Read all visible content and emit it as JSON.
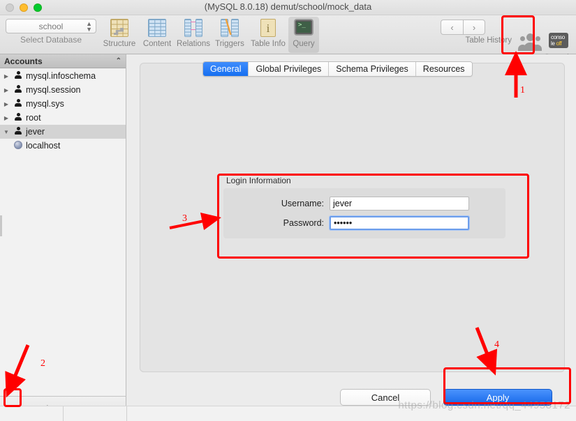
{
  "window": {
    "title": "(MySQL 8.0.18) demut/school/mock_data",
    "controls": {
      "close": "close-button",
      "minimize": "minimize-button",
      "maximize": "maximize-button"
    }
  },
  "toolbar": {
    "db_select_value": "school",
    "db_select_label": "Select Database",
    "items": [
      {
        "label": "Structure",
        "icon": "structure-icon",
        "selected": false
      },
      {
        "label": "Content",
        "icon": "content-icon",
        "selected": false
      },
      {
        "label": "Relations",
        "icon": "relations-icon",
        "selected": false
      },
      {
        "label": "Triggers",
        "icon": "triggers-icon",
        "selected": false
      },
      {
        "label": "Table Info",
        "icon": "table-info-icon",
        "selected": false
      },
      {
        "label": "Query",
        "icon": "query-icon",
        "selected": true
      }
    ],
    "nav_back": "‹",
    "nav_forward": "›",
    "table_history_label": "Table History",
    "users_label": "Users",
    "console_label": "Console",
    "console_icon_line1": "conso",
    "console_icon_line2a": "le ",
    "console_icon_line2b": "off"
  },
  "sidebar": {
    "header": "Accounts",
    "collapse_chevron": "⌃",
    "items": [
      {
        "label": "mysql.infoschema",
        "icon": "user-icon",
        "expanded": false,
        "selected": false,
        "child": false
      },
      {
        "label": "mysql.session",
        "icon": "user-icon",
        "expanded": false,
        "selected": false,
        "child": false
      },
      {
        "label": "mysql.sys",
        "icon": "user-icon",
        "expanded": false,
        "selected": false,
        "child": false
      },
      {
        "label": "root",
        "icon": "user-icon",
        "expanded": false,
        "selected": false,
        "child": false
      },
      {
        "label": "jever",
        "icon": "user-icon",
        "expanded": true,
        "selected": true,
        "child": false
      },
      {
        "label": "localhost",
        "icon": "globe-icon",
        "expanded": null,
        "selected": false,
        "child": true
      }
    ],
    "footer": {
      "add": "+",
      "remove": "−",
      "settings": "⚙",
      "settings_caret": "▾",
      "grip": "|||"
    }
  },
  "main": {
    "tabs": [
      {
        "label": "General",
        "active": true
      },
      {
        "label": "Global Privileges",
        "active": false
      },
      {
        "label": "Schema Privileges",
        "active": false
      },
      {
        "label": "Resources",
        "active": false
      }
    ],
    "login_information": {
      "group_title": "Login Information",
      "username_label": "Username:",
      "username_value": "jever",
      "username_placeholder": "",
      "password_label": "Password:",
      "password_value": "••••••",
      "password_placeholder": ""
    },
    "buttons": {
      "cancel": "Cancel",
      "apply": "Apply"
    }
  },
  "annotations": {
    "color": "#ff0000",
    "markers": [
      {
        "id": "1",
        "target": "users-toolbar-button"
      },
      {
        "id": "2",
        "target": "add-account-button"
      },
      {
        "id": "3",
        "target": "login-information-group"
      },
      {
        "id": "4",
        "target": "apply-button"
      }
    ]
  },
  "watermark": "https://blog.csdn.net/qq_44958172"
}
